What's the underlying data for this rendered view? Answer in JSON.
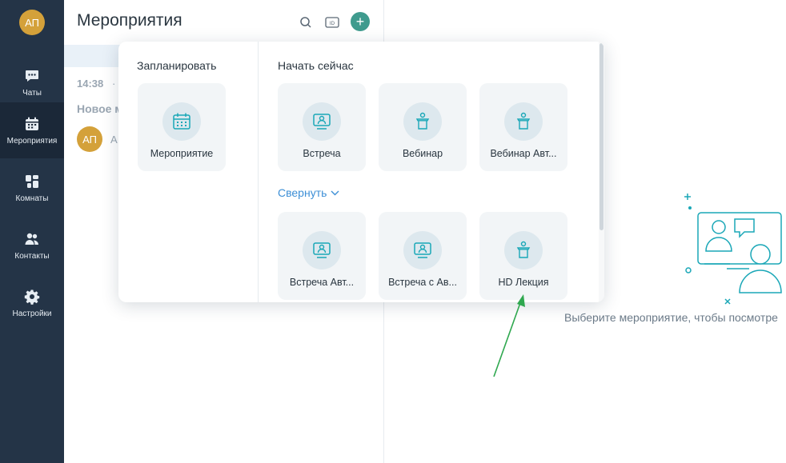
{
  "user": {
    "initials": "АП"
  },
  "nav": {
    "items": [
      {
        "label": "Чаты",
        "icon": "chat-icon"
      },
      {
        "label": "Мероприятия",
        "icon": "calendar-icon"
      },
      {
        "label": "Комнаты",
        "icon": "rooms-icon"
      },
      {
        "label": "Контакты",
        "icon": "contacts-icon"
      },
      {
        "label": "Настройки",
        "icon": "gear-icon"
      }
    ],
    "active": "Мероприятия"
  },
  "list": {
    "title": "Мероприятия",
    "time": "14:38",
    "dot": "·",
    "event_title": "Новое м",
    "participant_initials": "АП",
    "participant_name": "А"
  },
  "popup": {
    "scheduled": {
      "title": "Запланировать",
      "cards": [
        {
          "label": "Мероприятие",
          "icon": "calendar-icon"
        }
      ]
    },
    "start_now": {
      "title": "Начать сейчас",
      "cards": [
        {
          "label": "Встреча",
          "icon": "monitor-person-icon"
        },
        {
          "label": "Вебинар",
          "icon": "podium-icon"
        },
        {
          "label": "Вебинар Авт...",
          "icon": "podium-icon"
        }
      ],
      "collapse_label": "Свернуть",
      "more_cards": [
        {
          "label": "Встреча Авт...",
          "icon": "monitor-person-icon"
        },
        {
          "label": "Встреча с Ав...",
          "icon": "monitor-person-icon"
        },
        {
          "label": "HD Лекция",
          "icon": "podium-icon"
        }
      ]
    }
  },
  "empty_state": {
    "text": "Выберите мероприятие, чтобы посмотре"
  },
  "colors": {
    "rail": "#243447",
    "accent": "#3f9b8e",
    "link": "#3d8fd6",
    "avatar": "#d4a13a",
    "annotation_arrow": "#2fa84f"
  }
}
